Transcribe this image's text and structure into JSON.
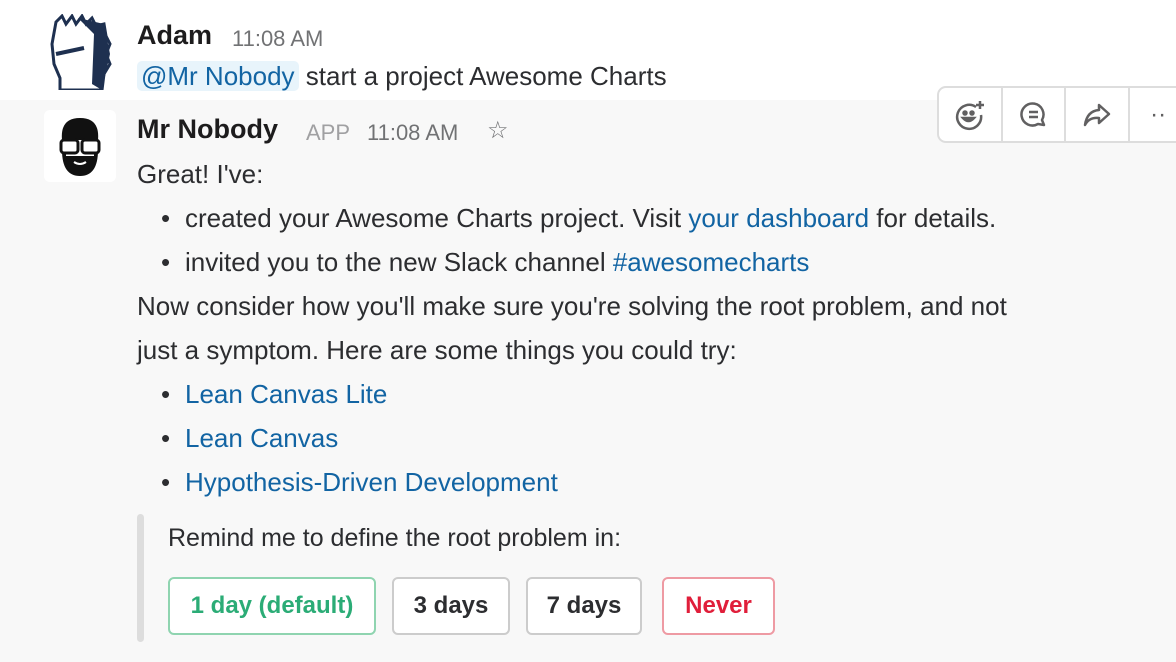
{
  "messages": [
    {
      "author": "Adam",
      "time": "11:08 AM",
      "mention": "@Mr Nobody",
      "text": "start a project Awesome Charts"
    },
    {
      "author": "Mr Nobody",
      "badge": "APP",
      "time": "11:08 AM",
      "intro": "Great! I've:",
      "bullets1": [
        {
          "pre": "created your Awesome Charts project. Visit ",
          "link": "your dashboard",
          "post": " for details."
        },
        {
          "pre": "invited you to the new Slack channel ",
          "link": "#awesomecharts",
          "post": ""
        }
      ],
      "para1": "Now consider how you'll make sure you're solving the root problem, and not",
      "para2": "just a symptom. Here are some things you could try:",
      "links": [
        "Lean Canvas Lite",
        "Lean Canvas",
        "Hypothesis-Driven Development"
      ],
      "attachment": {
        "text": "Remind me to define the root problem in:",
        "buttons": [
          {
            "label": "1 day (default)",
            "style": "primary",
            "color": "#2bac76"
          },
          {
            "label": "3 days",
            "style": "default"
          },
          {
            "label": "7 days",
            "style": "default"
          },
          {
            "label": "Never",
            "style": "danger",
            "color": "#e01e5a"
          }
        ]
      }
    }
  ],
  "toolbar": {
    "icons": [
      "add-reaction-icon",
      "thread-icon",
      "share-icon",
      "more-icon"
    ]
  }
}
